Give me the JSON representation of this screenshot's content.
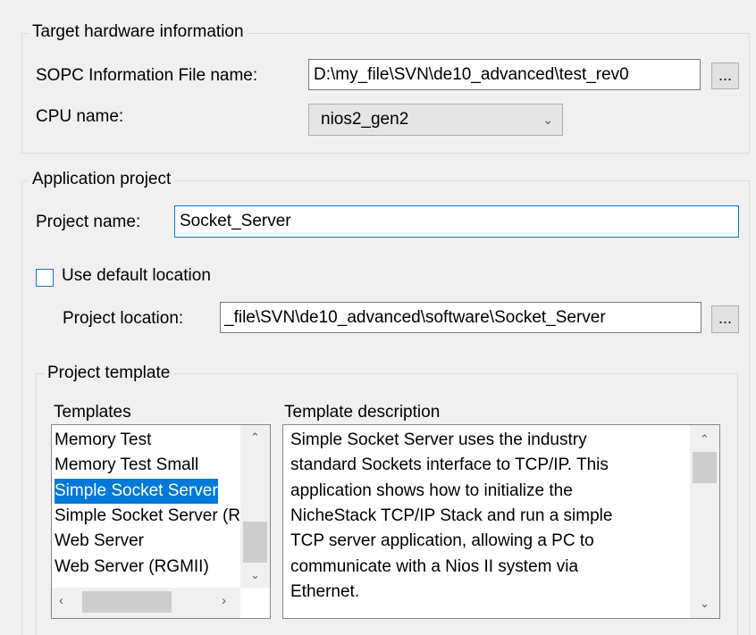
{
  "target_hw": {
    "title": "Target hardware information",
    "sopc_label": "SOPC Information File name:",
    "sopc_value": "D:\\my_file\\SVN\\de10_advanced\\test_rev0",
    "browse_label": "...",
    "cpu_label": "CPU name:",
    "cpu_value": "nios2_gen2"
  },
  "app_project": {
    "title": "Application project",
    "name_label": "Project name:",
    "name_value": "Socket_Server",
    "use_default_label": "Use default location",
    "use_default_checked": false,
    "location_label": "Project location:",
    "location_value": "_file\\SVN\\de10_advanced\\software\\Socket_Server",
    "browse_label": "..."
  },
  "template": {
    "title": "Project template",
    "templates_label": "Templates",
    "items": [
      {
        "label": "Memory Test"
      },
      {
        "label": "Memory Test Small"
      },
      {
        "label": "Simple Socket Server"
      },
      {
        "label": "Simple Socket Server (RGMII)"
      },
      {
        "label": "Web Server"
      },
      {
        "label": "Web Server (RGMII)"
      }
    ],
    "selected_index": 2,
    "description_label": "Template description",
    "description_lines": [
      "Simple Socket Server uses the industry",
      "standard Sockets interface to TCP/IP. This",
      "application shows how to initialize the",
      "NicheStack TCP/IP Stack and run a simple",
      "TCP server application, allowing a PC to",
      "communicate with a Nios II system via",
      "Ethernet."
    ]
  }
}
